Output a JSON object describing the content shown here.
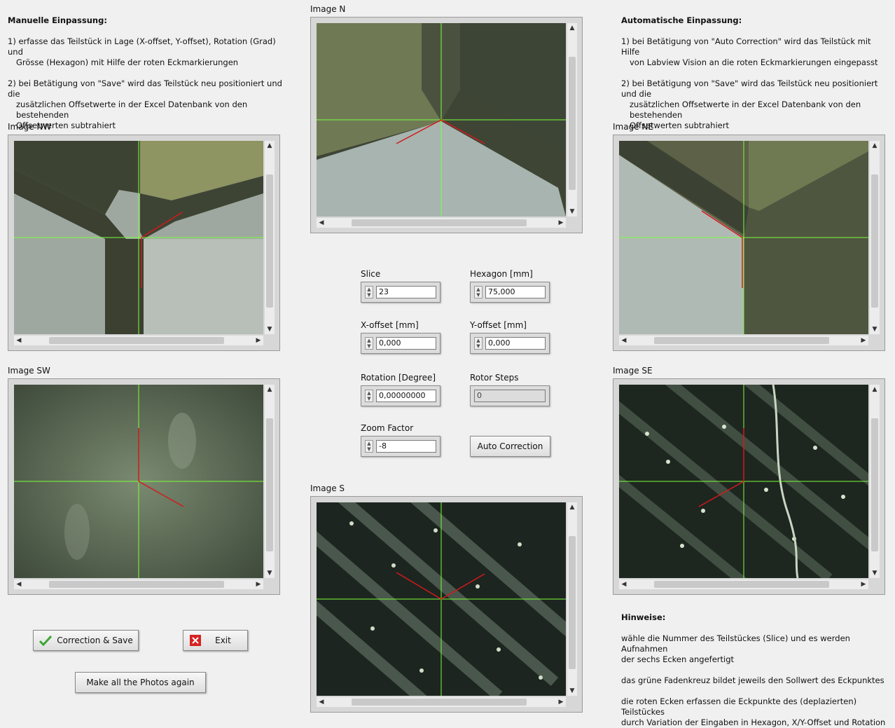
{
  "left_text": {
    "title": "Manuelle Einpassung:",
    "item1": [
      "1) erfasse das Teilstück in Lage (X-offset, Y-offset), Rotation (Grad) und",
      "Grösse (Hexagon) mit Hilfe der roten Eckmarkierungen"
    ],
    "item2": [
      "2) bei Betätigung von \"Save\" wird das Teilstück neu positioniert und die",
      "zusätzlichen Offsetwerte in der Excel Datenbank von den bestehenden",
      "Offsetwerten subtrahiert"
    ]
  },
  "right_text": {
    "title": "Automatische Einpassung:",
    "item1": [
      "1) bei Betätigung von \"Auto Correction\" wird das Teilstück mit Hilfe",
      "von Labview Vision an die roten Eckmarkierungen eingepasst"
    ],
    "item2": [
      "2) bei Betätigung von \"Save\" wird das Teilstück neu positioniert und die",
      "zusätzlichen Offsetwerte in der Excel Datenbank von den bestehenden",
      "Offsetwerten subtrahiert"
    ]
  },
  "images": {
    "n": "Image N",
    "nw": "Image NW",
    "ne": "Image NE",
    "sw": "Image SW",
    "se": "Image SE",
    "s": "Image S"
  },
  "controls": {
    "slice": {
      "label": "Slice",
      "value": "23"
    },
    "hexagon": {
      "label": "Hexagon [mm]",
      "value": "75,000"
    },
    "x_offset": {
      "label": "X-offset [mm]",
      "value": "0,000"
    },
    "y_offset": {
      "label": "Y-offset [mm]",
      "value": "0,000"
    },
    "rotation": {
      "label": "Rotation [Degree]",
      "value": "0,00000000"
    },
    "rotor_steps": {
      "label": "Rotor Steps",
      "value": "0"
    },
    "zoom": {
      "label": "Zoom Factor",
      "value": "-8"
    },
    "auto_correction": "Auto Correction"
  },
  "buttons": {
    "correction_save": "Correction & Save",
    "exit": "Exit",
    "make_photos": "Make all the Photos again"
  },
  "hints": {
    "title": "Hinweise:",
    "h1": [
      "wähle die Nummer des  Teilstückes (Slice) und es werden Aufnahmen",
      "der sechs Ecken angefertigt"
    ],
    "h2": "das grüne Fadenkreuz bildet jeweils den Sollwert des Eckpunktes",
    "h3": [
      "die roten Ecken erfassen die Eckpunkte des (deplazierten) Teilstückes",
      "durch Variation der Eingaben in Hexagon, X/Y-Offset und Rotation"
    ]
  },
  "colors": {
    "crosshair": "#7cff3a",
    "corner_marker": "#d21a1a",
    "save_icon": "#3aa832",
    "exit_icon": "#d62222"
  }
}
